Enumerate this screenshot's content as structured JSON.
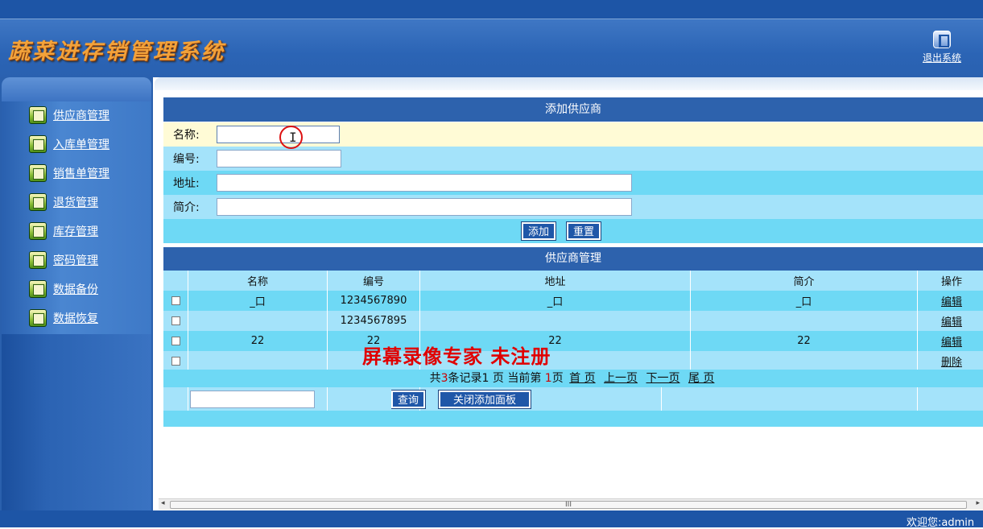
{
  "app": {
    "title": "蔬菜进存销管理系统",
    "exit_label": "退出系统"
  },
  "sidebar": {
    "items": [
      {
        "label": "供应商管理"
      },
      {
        "label": "入库单管理"
      },
      {
        "label": "销售单管理"
      },
      {
        "label": "退货管理"
      },
      {
        "label": "库存管理"
      },
      {
        "label": "密码管理"
      },
      {
        "label": "数据备份"
      },
      {
        "label": "数据恢复"
      }
    ]
  },
  "add_form": {
    "title": "添加供应商",
    "fields": [
      {
        "label": "名称:",
        "value": ""
      },
      {
        "label": "编号:",
        "value": ""
      },
      {
        "label": "地址:",
        "value": ""
      },
      {
        "label": "简介:",
        "value": ""
      }
    ],
    "add_button": "添加",
    "reset_button": "重置"
  },
  "supplier_table": {
    "title": "供应商管理",
    "columns": [
      "名称",
      "编号",
      "地址",
      "简介",
      "操作"
    ],
    "rows": [
      {
        "name": "_口",
        "code": "1234567890",
        "address": "_口",
        "intro": "_口",
        "op": "编辑"
      },
      {
        "name": "",
        "code": "1234567895",
        "address": "",
        "intro": "",
        "op": "编辑"
      },
      {
        "name": "22",
        "code": "22",
        "address": "22",
        "intro": "22",
        "op": "编辑"
      },
      {
        "name": "",
        "code": "",
        "address": "",
        "intro": "",
        "op": "删除"
      }
    ],
    "pager": {
      "prefix": "共",
      "total": "3",
      "records_text": "条记录",
      "pages": "1",
      "page_text": "页 当前第",
      "current": "1",
      "page_suffix": "页",
      "first": "首 页",
      "prev": "上一页",
      "next": "下一页",
      "last": "尾 页"
    },
    "search": {
      "value": "",
      "query_button": "查询",
      "close_button": "关闭添加面板"
    }
  },
  "footer": {
    "welcome": "欢迎您:admin"
  },
  "watermark": "屏幕录像专家  未注册",
  "scrollbar": {
    "grip": "III"
  },
  "colors": {
    "brand_blue": "#1d55a6",
    "row_cyan": "#6ed9f5",
    "row_light": "#a4e3fa",
    "row_cream": "#fffbd6"
  }
}
